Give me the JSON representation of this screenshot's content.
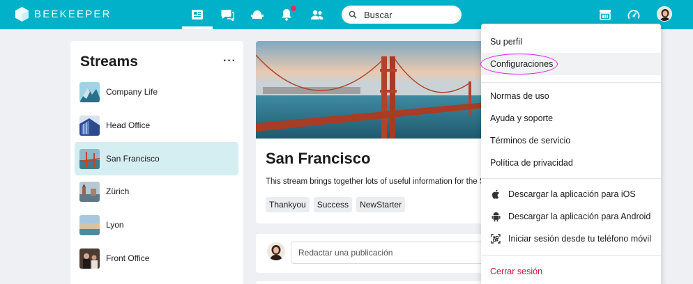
{
  "app": {
    "brand": "BEEKEEPER",
    "accent_color": "#00b1c9",
    "notification_color": "#e5324c"
  },
  "topbar": {
    "nav_icons": [
      "news-feed-icon",
      "chat-icon",
      "workplace-icon",
      "notifications-icon",
      "people-icon"
    ],
    "active_nav": "news-feed-icon",
    "search_placeholder": "Buscar",
    "right_icons": [
      "tools-icon",
      "speedometer-icon",
      "avatar"
    ]
  },
  "streams": {
    "title": "Streams",
    "more_label": "···",
    "items": [
      {
        "label": "Company Life",
        "active": false
      },
      {
        "label": "Head Office",
        "active": false
      },
      {
        "label": "San Francisco",
        "active": true
      },
      {
        "label": "Zürich",
        "active": false
      },
      {
        "label": "Lyon",
        "active": false
      },
      {
        "label": "Front Office",
        "active": false
      }
    ]
  },
  "stream_card": {
    "title": "San Francisco",
    "description": "This stream brings together lots of useful information for the S",
    "tags": [
      "Thankyou",
      "Success",
      "NewStarter"
    ]
  },
  "compose": {
    "placeholder": "Redactar una publicación"
  },
  "menu": {
    "items": [
      {
        "label": "Su perfil"
      },
      {
        "label": "Configuraciones"
      },
      {
        "label": "Normas de uso"
      },
      {
        "label": "Ayuda y soporte"
      },
      {
        "label": "Términos de servicio"
      },
      {
        "label": "Política de privacidad"
      },
      {
        "label": "Descargar la aplicación para iOS",
        "icon": "apple-icon"
      },
      {
        "label": "Descargar la aplicación para Android",
        "icon": "android-icon"
      },
      {
        "label": "Iniciar sesión desde tu teléfono móvil",
        "icon": "qr-code-icon"
      },
      {
        "label": "Cerrar sesión",
        "color": "#d6113c"
      }
    ],
    "highlighted": "Configuraciones",
    "annotation_color": "#e81ee8"
  }
}
